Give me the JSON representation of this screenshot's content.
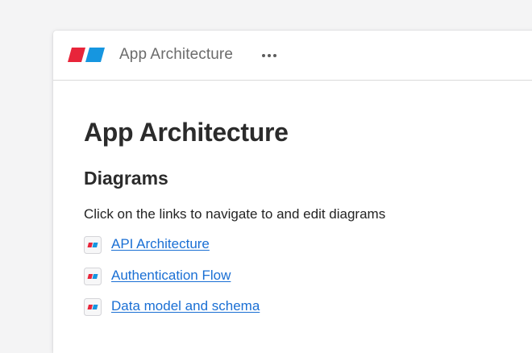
{
  "topbar": {
    "title": "App Architecture",
    "more_icon": "more-horizontal-icon",
    "logo_colors": {
      "left": "#e8253a",
      "right": "#1696e0"
    }
  },
  "page": {
    "title": "App Architecture",
    "section_heading": "Diagrams",
    "intro": "Click on the links to navigate to and edit diagrams"
  },
  "links": [
    {
      "label": "API Architecture",
      "icon": "diagram-file-icon"
    },
    {
      "label": "Authentication Flow",
      "icon": "diagram-file-icon"
    },
    {
      "label": "Data model and schema",
      "icon": "diagram-file-icon"
    }
  ],
  "colors": {
    "link": "#1a6fd4",
    "heading": "#2b2b2b",
    "muted": "#6b6b6b"
  }
}
